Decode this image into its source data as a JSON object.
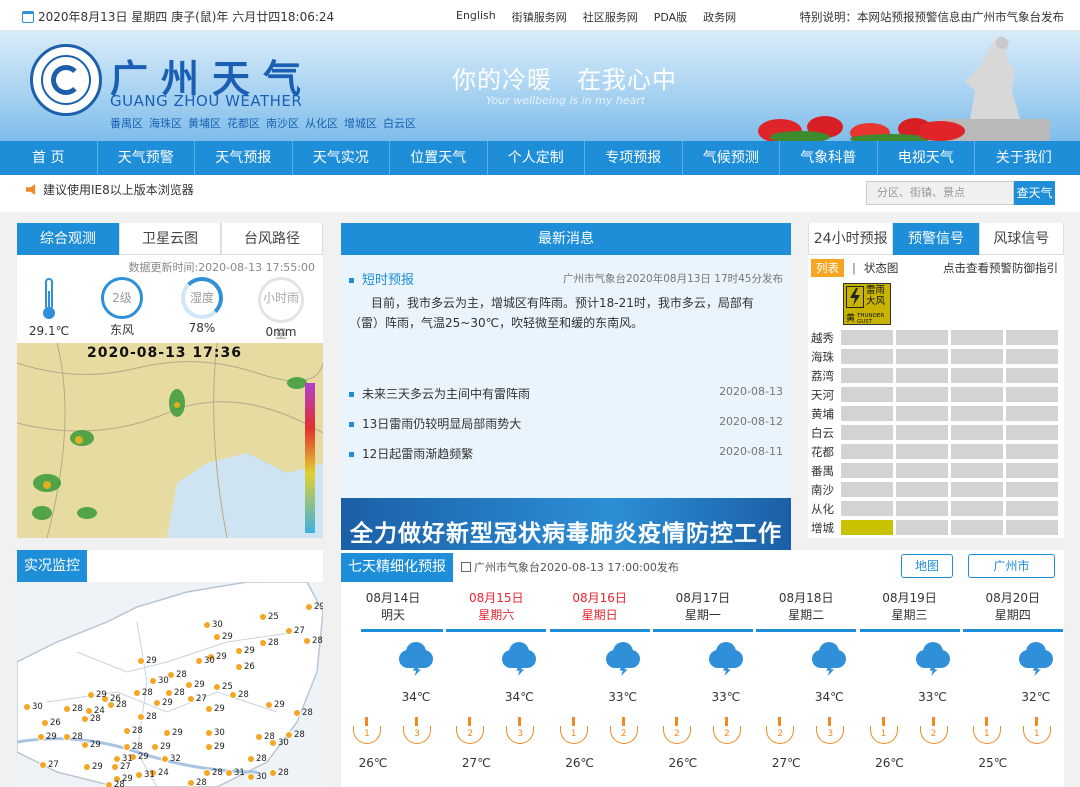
{
  "topbar": {
    "date": "2020年8月13日 星期四 庚子(鼠)年 六月廿四18:06:24",
    "links": [
      "English",
      "街镇服务网",
      "社区服务网",
      "PDA版",
      "政务网"
    ],
    "notice": "特别说明：本网站预报预警信息由广州市气象台发布"
  },
  "banner": {
    "title_cn": "广州天气",
    "title_en": "GUANG ZHOU WEATHER",
    "districts": [
      "番禺区",
      "海珠区",
      "黄埔区",
      "花都区",
      "南沙区",
      "从化区",
      "增城区",
      "白云区"
    ],
    "slogan": "你的冷暖　在我心中",
    "slogan_en": "Your wellbeing is in my heart"
  },
  "nav": [
    "首 页",
    "天气预警",
    "天气预报",
    "天气实况",
    "位置天气",
    "个人定制",
    "专项预报",
    "气候预测",
    "气象科普",
    "电视天气",
    "关于我们"
  ],
  "subbar": {
    "ie_note": "建议使用IE8以上版本浏览器",
    "search_placeholder": "分区、街镇、景点",
    "search_button": "查天气"
  },
  "obs_panel": {
    "tabs": [
      "综合观测",
      "卫星云图",
      "台风路径"
    ],
    "update_time": "数据更新时间:2020-08-13 17:55:00",
    "items": [
      {
        "icon": "thermometer-icon",
        "badge": "",
        "value": "29.1℃"
      },
      {
        "icon": "wind-direction-icon",
        "badge": "2级",
        "value": "东风"
      },
      {
        "icon": "humidity-icon",
        "badge": "湿度",
        "value": "78%"
      },
      {
        "icon": "rain-icon",
        "badge": "小时雨量",
        "value": "0mm"
      }
    ],
    "radar_time": "2020-08-13 17:36"
  },
  "news": {
    "title": "最新消息",
    "short_title": "短时预报",
    "short_src": "广州市气象台2020年08月13日 17时45分发布",
    "short_text": "目前，我市多云为主，增城区有阵雨。预计18-21时，我市多云，局部有（雷）阵雨，气温25~30℃，吹轻微至和缓的东南风。",
    "items": [
      {
        "title": "未来三天多云为主间中有雷阵雨",
        "date": "2020-08-13"
      },
      {
        "title": "13日雷雨仍较明显局部雨势大",
        "date": "2020-08-12"
      },
      {
        "title": "12日起雷雨渐趋频繁",
        "date": "2020-08-11"
      }
    ],
    "banner_text": "全力做好新型冠状病毒肺炎疫情防控工作"
  },
  "warning": {
    "tabs": [
      "24小时预报",
      "预警信号",
      "风球信号"
    ],
    "list_label": "列表",
    "map_label": "状态图",
    "guide_link": "点击查看预警防御指引",
    "signal_text": "雷雨大风",
    "signal_level": "黄",
    "signal_en": "THUNDER GUST",
    "areas": [
      "越秀",
      "海珠",
      "荔湾",
      "天河",
      "黄埔",
      "白云",
      "花都",
      "番禺",
      "南沙",
      "从化",
      "增城"
    ],
    "active_area": "增城",
    "active_color": "#c8c200"
  },
  "monitor": {
    "title": "实况监控",
    "points": [
      "25",
      "29",
      "30",
      "27",
      "29",
      "28",
      "28",
      "29",
      "29",
      "30",
      "29",
      "26",
      "28",
      "30",
      "29",
      "25",
      "28",
      "28",
      "26",
      "29",
      "27",
      "28",
      "24",
      "28",
      "28",
      "29",
      "28",
      "26",
      "30",
      "28",
      "29",
      "29",
      "28",
      "29",
      "28",
      "28",
      "28",
      "30",
      "28",
      "29",
      "29",
      "29",
      "28",
      "29",
      "30",
      "32",
      "27",
      "28",
      "27",
      "24",
      "29",
      "29",
      "28",
      "28",
      "28",
      "31",
      "30",
      "29",
      "31",
      "31",
      "28",
      "30",
      "30"
    ]
  },
  "forecast": {
    "title": "七天精细化预报",
    "src": "广州市气象台2020-08-13 17:00:00发布",
    "btn_map": "地图",
    "btn_city": "广州市",
    "days": [
      {
        "date": "08月14日",
        "week": "明天",
        "red": false,
        "hi": "34℃",
        "lo": "26℃",
        "w1": "1",
        "w2": "3"
      },
      {
        "date": "08月15日",
        "week": "星期六",
        "red": true,
        "hi": "34℃",
        "lo": "27℃",
        "w1": "2",
        "w2": "3"
      },
      {
        "date": "08月16日",
        "week": "星期日",
        "red": true,
        "hi": "33℃",
        "lo": "26℃",
        "w1": "1",
        "w2": "2"
      },
      {
        "date": "08月17日",
        "week": "星期一",
        "red": false,
        "hi": "33℃",
        "lo": "26℃",
        "w1": "2",
        "w2": "2"
      },
      {
        "date": "08月18日",
        "week": "星期二",
        "red": false,
        "hi": "34℃",
        "lo": "27℃",
        "w1": "2",
        "w2": "3"
      },
      {
        "date": "08月19日",
        "week": "星期三",
        "red": false,
        "hi": "33℃",
        "lo": "26℃",
        "w1": "1",
        "w2": "2"
      },
      {
        "date": "08月20日",
        "week": "星期四",
        "red": false,
        "hi": "32℃",
        "lo": "25℃",
        "w1": "1",
        "w2": "1"
      }
    ]
  }
}
